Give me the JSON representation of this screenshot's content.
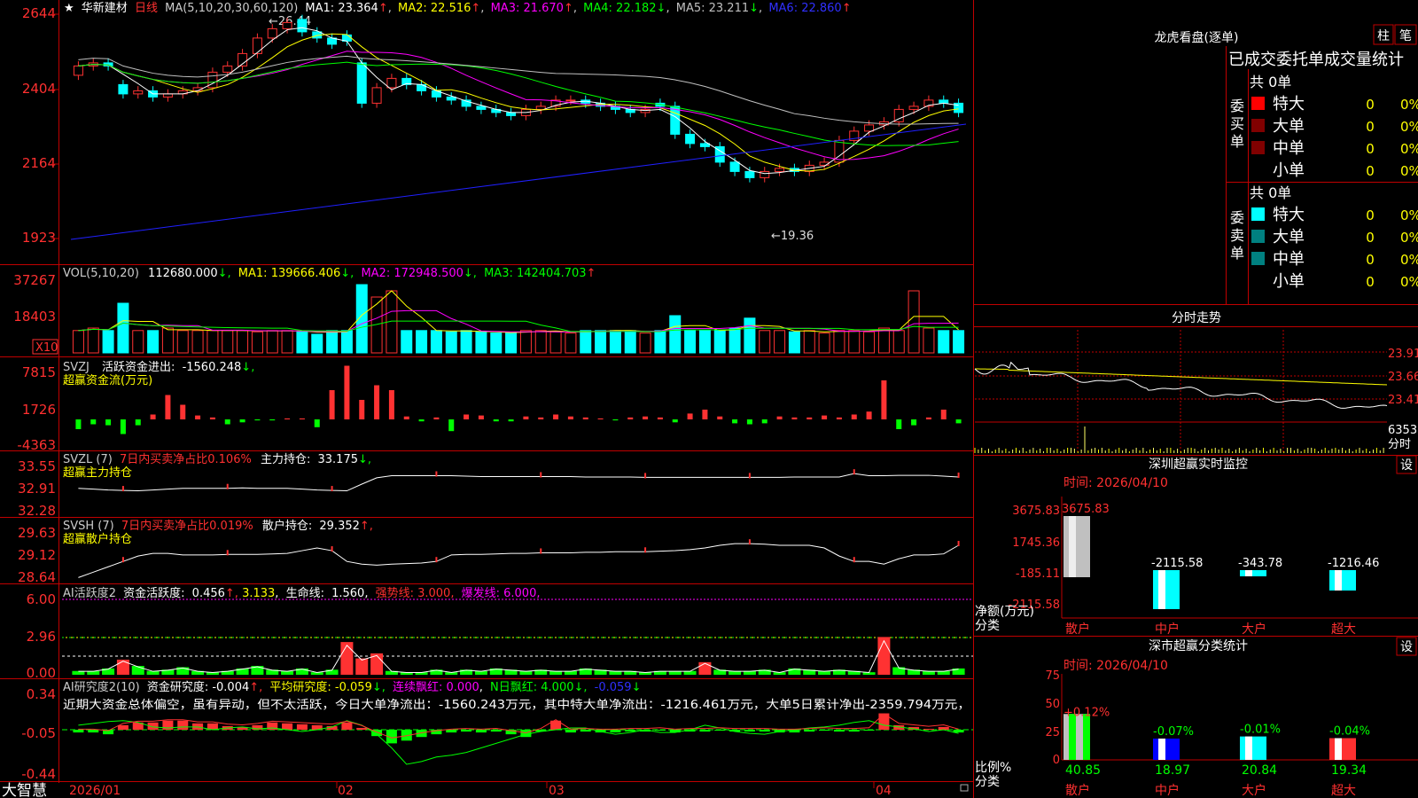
{
  "colors": {
    "red": "#ff3232",
    "cyan": "#00ffff",
    "white": "#ffffff",
    "yellow": "#ffff00",
    "magenta": "#ff00ff",
    "green": "#00ff00",
    "blue": "#0000ff",
    "gray": "#c0c0c0",
    "frame": "#c00000",
    "label": "#ff3030"
  },
  "topbar": {
    "star": "★",
    "stock_name": "华新建材",
    "period": "日线",
    "ma_params": "MA(5,10,20,30,60,120)",
    "ma": [
      {
        "label": "MA1: 23.364",
        "arrow": "↑"
      },
      {
        "label": "MA2: 22.516",
        "arrow": "↑"
      },
      {
        "label": "MA3: 21.670",
        "arrow": "↑"
      },
      {
        "label": "MA4: 22.182",
        "arrow": "↓"
      },
      {
        "label": "MA5: 23.211",
        "arrow": "↓"
      },
      {
        "label": "MA6: 22.860",
        "arrow": "↑"
      }
    ]
  },
  "price_axis": [
    "2644",
    "2404",
    "2164",
    "1923"
  ],
  "price_marks": {
    "high": "26.44",
    "low": "19.36"
  },
  "vol": {
    "title": "VOL(5,10,20)",
    "value": "112680.000",
    "ma1": "MA1: 139666.406",
    "ma2": "MA2: 172948.500",
    "ma3": "MA3: 142404.703",
    "axis": [
      "37267",
      "18403"
    ],
    "unit": "X10"
  },
  "svzj": {
    "title": "SVZJ",
    "label": "活跃资金进出:",
    "value": "-1560.248",
    "subtitle": "超赢资金流(万元)",
    "axis": [
      "7815",
      "1726",
      "-4363"
    ]
  },
  "svzl": {
    "title": "SVZL (7)",
    "ratio": "7日内买卖净占比0.106%",
    "hold_label": "主力持仓:",
    "hold_value": "33.175",
    "subtitle": "超赢主力持仓",
    "axis": [
      "33.55",
      "32.91",
      "32.28"
    ]
  },
  "svsh": {
    "title": "SVSH (7)",
    "ratio": "7日内买卖净占比0.019%",
    "hold_label": "散户持仓:",
    "hold_value": "29.352",
    "subtitle": "超赢散户持仓",
    "axis": [
      "29.63",
      "29.12",
      "28.64"
    ]
  },
  "ai1": {
    "title": "AI活跃度2",
    "label": "资金活跃度:",
    "v1": "0.456",
    "v2": "3.133",
    "life_label": "生命线:",
    "life": "1.560",
    "strong": "强势线: 3.000",
    "burst": "爆发线: 6.000",
    "axis": [
      "6.00",
      "2.96",
      "0.00"
    ]
  },
  "ai2": {
    "title": "AI研究度2(10)",
    "research": "资金研究度: -0.004",
    "avg": "平均研究度: -0.059",
    "lianxu": "连续飘红: 0.000",
    "nday": "N日飘红: 4.000",
    "last": "-0.059",
    "comment": "近期大资金总体偏空，虽有异动，但不太活跃，今日大单净流出：-1560.243万元，其中特大单净流出：-1216.461万元，大单5日累计净出-2359.794万元，",
    "axis": [
      "0.34",
      "-0.05",
      "-0.44"
    ]
  },
  "xaxis": {
    "labels": [
      "2026/01",
      "02",
      "03",
      "04"
    ]
  },
  "brand": "大智慧",
  "longhu": {
    "title": "龙虎看盘(逐单)",
    "btn1": "柱",
    "btn2": "笔",
    "subtitle": "已成交委托单成交量统计",
    "buy": {
      "label": "委买单",
      "total": "共 0单",
      "rows": [
        {
          "name": "特大",
          "n": "0",
          "p": "0%"
        },
        {
          "name": "大单",
          "n": "0",
          "p": "0%"
        },
        {
          "name": "中单",
          "n": "0",
          "p": "0%"
        },
        {
          "name": "小单",
          "n": "0",
          "p": "0%"
        }
      ]
    },
    "sell": {
      "label": "委卖单",
      "total": "共 0单",
      "rows": [
        {
          "name": "特大",
          "n": "0",
          "p": "0%"
        },
        {
          "name": "大单",
          "n": "0",
          "p": "0%"
        },
        {
          "name": "中单",
          "n": "0",
          "p": "0%"
        },
        {
          "name": "小单",
          "n": "0",
          "p": "0%"
        }
      ]
    }
  },
  "fenshi": {
    "title": "分时走势",
    "axis": [
      "23.91",
      "23.66",
      "23.41"
    ],
    "vol": "6353",
    "unit": "分时"
  },
  "monitor": {
    "title": "深圳超赢实时监控",
    "btn": "设",
    "time": "时间: 2026/04/10",
    "axis": [
      "3675.83",
      "1745.36",
      "-185.11",
      "-2115.58"
    ],
    "unit": "净额(万元)",
    "cat": "分类",
    "cats": [
      "散户",
      "中户",
      "大户",
      "超大"
    ],
    "values": [
      "3675.83",
      "-2115.58",
      "-343.78",
      "-1216.46"
    ]
  },
  "classify": {
    "title": "深市超赢分类统计",
    "btn": "设",
    "time": "时间: 2026/04/10",
    "axis": [
      "75",
      "50",
      "25",
      "0"
    ],
    "unit": "比例%",
    "cat": "分类",
    "cats": [
      "散户",
      "中户",
      "大户",
      "超大"
    ],
    "values": [
      "40.85",
      "18.97",
      "20.84",
      "19.34"
    ],
    "changes": [
      "+0.12%",
      "-0.07%",
      "-0.01%",
      "-0.04%"
    ]
  },
  "chart_data": {
    "type": "bar",
    "title": "深圳超赢实时监控",
    "categories": [
      "散户",
      "中户",
      "大户",
      "超大"
    ],
    "values": [
      3675.83,
      -2115.58,
      -343.78,
      -1216.46
    ],
    "ylabel": "净额(万元)",
    "ylim": [
      -2115.58,
      3675.83
    ]
  }
}
